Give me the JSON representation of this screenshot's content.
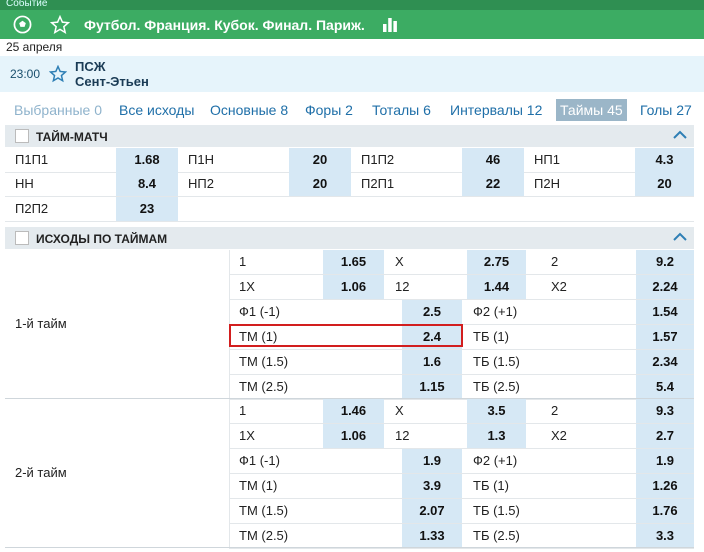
{
  "header": {
    "crumb": "Событие",
    "title": "Футбол. Франция. Кубок. Финал. Париж."
  },
  "event": {
    "date": "25 апреля",
    "time": "23:00",
    "team1": "ПСЖ",
    "team2": "Сент-Этьен"
  },
  "tabs": [
    {
      "label": "Выбранные 0"
    },
    {
      "label": "Все исходы"
    },
    {
      "label": "Основные 8"
    },
    {
      "label": "Форы 2"
    },
    {
      "label": "Тоталы 6"
    },
    {
      "label": "Интервалы 12"
    },
    {
      "label": "Таймы 45"
    },
    {
      "label": "Голы 27"
    }
  ],
  "tm": {
    "title": "ТАЙМ-МАТЧ",
    "rows": [
      [
        {
          "l": "П1П1",
          "v": "1.68"
        },
        {
          "l": "П1Н",
          "v": "20"
        },
        {
          "l": "П1П2",
          "v": "46"
        },
        {
          "l": "НП1",
          "v": "4.3"
        }
      ],
      [
        {
          "l": "НН",
          "v": "8.4"
        },
        {
          "l": "НП2",
          "v": "20"
        },
        {
          "l": "П2П1",
          "v": "22"
        },
        {
          "l": "П2Н",
          "v": "20"
        }
      ],
      [
        {
          "l": "П2П2",
          "v": "23"
        }
      ]
    ]
  },
  "ip": {
    "title": "ИСХОДЫ ПО ТАЙМАМ",
    "periods": [
      {
        "name": "1-й тайм",
        "r3": [
          [
            {
              "l": "1",
              "v": "1.65"
            },
            {
              "l": "X",
              "v": "2.75"
            },
            {
              "l": "2",
              "v": "9.2"
            }
          ],
          [
            {
              "l": "1X",
              "v": "1.06"
            },
            {
              "l": "12",
              "v": "1.44"
            },
            {
              "l": "X2",
              "v": "2.24"
            }
          ]
        ],
        "r2": [
          [
            {
              "l": "Ф1 (-1)",
              "v": "2.5"
            },
            {
              "l": "Ф2 (+1)",
              "v": "1.54"
            }
          ],
          [
            {
              "l": "ТМ (1)",
              "v": "2.4"
            },
            {
              "l": "ТБ (1)",
              "v": "1.57"
            }
          ],
          [
            {
              "l": "ТМ (1.5)",
              "v": "1.6"
            },
            {
              "l": "ТБ (1.5)",
              "v": "2.34"
            }
          ],
          [
            {
              "l": "ТМ (2.5)",
              "v": "1.15"
            },
            {
              "l": "ТБ (2.5)",
              "v": "5.4"
            }
          ]
        ]
      },
      {
        "name": "2-й тайм",
        "r3": [
          [
            {
              "l": "1",
              "v": "1.46"
            },
            {
              "l": "X",
              "v": "3.5"
            },
            {
              "l": "2",
              "v": "9.3"
            }
          ],
          [
            {
              "l": "1X",
              "v": "1.06"
            },
            {
              "l": "12",
              "v": "1.3"
            },
            {
              "l": "X2",
              "v": "2.7"
            }
          ]
        ],
        "r2": [
          [
            {
              "l": "Ф1 (-1)",
              "v": "1.9"
            },
            {
              "l": "Ф2 (+1)",
              "v": "1.9"
            }
          ],
          [
            {
              "l": "ТМ (1)",
              "v": "3.9"
            },
            {
              "l": "ТБ (1)",
              "v": "1.26"
            }
          ],
          [
            {
              "l": "ТМ (1.5)",
              "v": "2.07"
            },
            {
              "l": "ТБ (1.5)",
              "v": "1.76"
            }
          ],
          [
            {
              "l": "ТМ (2.5)",
              "v": "1.33"
            },
            {
              "l": "ТБ (2.5)",
              "v": "3.3"
            }
          ]
        ]
      }
    ]
  },
  "colors": {
    "green": "#3cac63",
    "odds_bg": "#d6e8f5",
    "link": "#1f6fa8",
    "highlight": "#d21e1e"
  },
  "icons": [
    "soccer-ball-icon",
    "star-icon",
    "stats-icon",
    "chevron-up-icon"
  ]
}
